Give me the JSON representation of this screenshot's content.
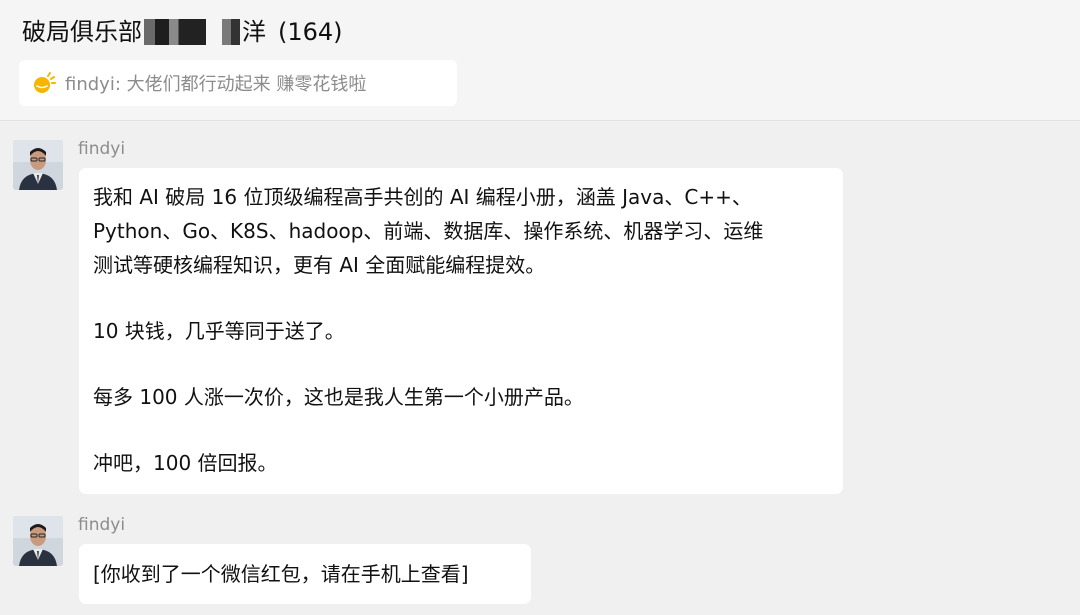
{
  "chat": {
    "title": "破局俱乐部",
    "title_suffix": "洋",
    "member_count": "(164)"
  },
  "pinned": {
    "icon": "announcement-icon",
    "text": "findyi: 大佬们都行动起来 赚零花钱啦"
  },
  "messages": [
    {
      "sender": "findyi",
      "lines": [
        "我和 AI 破局 16 位顶级编程高手共创的 AI 编程小册，涵盖 Java、C++、",
        "Python、Go、K8S、hadoop、前端、数据库、操作系统、机器学习、运维",
        "测试等硬核编程知识，更有 AI 全面赋能编程提效。",
        "10 块钱，几乎等同于送了。",
        "每多 100 人涨一次价，这也是我人生第一个小册产品。",
        "冲吧，100 倍回报。"
      ]
    },
    {
      "sender": "findyi",
      "lines": [
        "[你收到了一个微信红包，请在手机上查看]"
      ]
    }
  ],
  "colors": {
    "background": "#f0f0f0",
    "bubble": "#ffffff",
    "muted_text": "#8d8d8d",
    "pinned_icon": "#f7b500"
  }
}
